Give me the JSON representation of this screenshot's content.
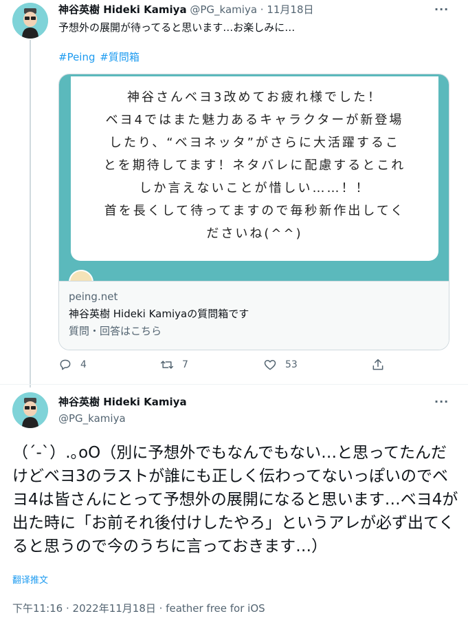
{
  "tweet1": {
    "author_name": "神谷英樹 Hideki Kamiya",
    "handle": "@PG_kamiya",
    "date": "11月18日",
    "text": "予想外の展開が待ってると思います…お楽しみに…",
    "hashtags": [
      "#Peing",
      "#質問箱"
    ],
    "card": {
      "image_lines": [
        "神谷さんベヨ3改めてお疲れ様でした！",
        "ベヨ4ではまた魅力あるキャラクターが新登場",
        "したり、“ベヨネッタ”がさらに大活躍するこ",
        "とを期待してます！ネタバレに配慮するとこれ",
        "しか言えないことが惜しい……！！",
        "首を長くして待ってますので毎秒新作出してく",
        "ださいね(^^)"
      ],
      "domain": "peing.net",
      "title": "神谷英樹 Hideki Kamiyaの質問箱です",
      "description": "質問・回答はこちら"
    },
    "actions": {
      "replies": "4",
      "retweets": "7",
      "likes": "53"
    }
  },
  "tweet2": {
    "author_name": "神谷英樹 Hideki Kamiya",
    "handle": "@PG_kamiya",
    "text": "（´-`）.｡oO（別に予想外でもなんでもない…と思ってたんだけどベヨ3のラストが誰にも正しく伝わってないっぽいのでベヨ4は皆さんにとって予想外の展開になると思います…ベヨ4が出た時に「お前それ後付けしたやろ」というアレが必ず出てくると思うので今のうちに言っておきます…）",
    "translate_label": "翻译推文",
    "timestamp": "下午11:16 · 2022年11月18日 · feather free for iOS"
  },
  "icons": [
    "avatar-icon",
    "more-icon",
    "reply-icon",
    "retweet-icon",
    "like-icon",
    "share-icon"
  ],
  "colors": {
    "link": "#1d9bf0",
    "secondary": "#536471",
    "card_bg": "#5bb9bc",
    "avatar_bg": "#7fd3d8"
  }
}
